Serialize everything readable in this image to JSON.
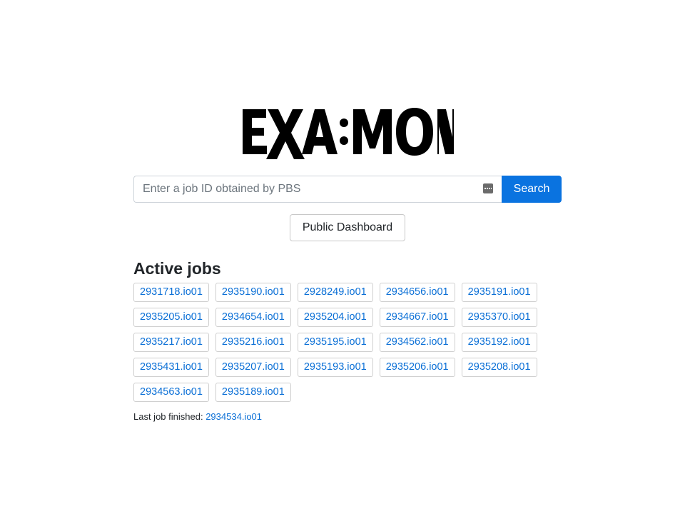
{
  "logo": {
    "text": "EXA:MON"
  },
  "search": {
    "placeholder": "Enter a job ID obtained by PBS",
    "value": "",
    "autofill_icon": "autofill-key-icon",
    "button_label": "Search"
  },
  "public_dashboard_label": "Public Dashboard",
  "active_jobs": {
    "title": "Active jobs",
    "rows": [
      [
        "2931718.io01",
        "2935190.io01",
        "2928249.io01",
        "2934656.io01",
        "2935191.io01"
      ],
      [
        "2935205.io01",
        "2934654.io01",
        "2935204.io01",
        "2934667.io01",
        "2935370.io01"
      ],
      [
        "2935217.io01",
        "2935216.io01",
        "2935195.io01",
        "2934562.io01",
        "2935192.io01"
      ],
      [
        "2935431.io01",
        "2935207.io01",
        "2935193.io01",
        "2935206.io01",
        "2935208.io01"
      ],
      [
        "2934563.io01",
        "2935189.io01"
      ]
    ]
  },
  "last_job": {
    "label": "Last job finished:",
    "id": "2934534.io01"
  },
  "colors": {
    "accent": "#0a73e0",
    "link": "#0a6fd6"
  }
}
